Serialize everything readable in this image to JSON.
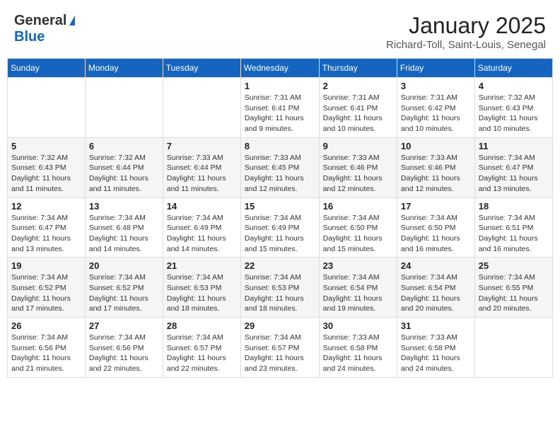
{
  "header": {
    "logo_general": "General",
    "logo_blue": "Blue",
    "main_title": "January 2025",
    "subtitle": "Richard-Toll, Saint-Louis, Senegal"
  },
  "calendar": {
    "days_of_week": [
      "Sunday",
      "Monday",
      "Tuesday",
      "Wednesday",
      "Thursday",
      "Friday",
      "Saturday"
    ],
    "weeks": [
      [
        {
          "day": "",
          "info": ""
        },
        {
          "day": "",
          "info": ""
        },
        {
          "day": "",
          "info": ""
        },
        {
          "day": "1",
          "info": "Sunrise: 7:31 AM\nSunset: 6:41 PM\nDaylight: 11 hours and 9 minutes."
        },
        {
          "day": "2",
          "info": "Sunrise: 7:31 AM\nSunset: 6:41 PM\nDaylight: 11 hours and 10 minutes."
        },
        {
          "day": "3",
          "info": "Sunrise: 7:31 AM\nSunset: 6:42 PM\nDaylight: 11 hours and 10 minutes."
        },
        {
          "day": "4",
          "info": "Sunrise: 7:32 AM\nSunset: 6:43 PM\nDaylight: 11 hours and 10 minutes."
        }
      ],
      [
        {
          "day": "5",
          "info": "Sunrise: 7:32 AM\nSunset: 6:43 PM\nDaylight: 11 hours and 11 minutes."
        },
        {
          "day": "6",
          "info": "Sunrise: 7:32 AM\nSunset: 6:44 PM\nDaylight: 11 hours and 11 minutes."
        },
        {
          "day": "7",
          "info": "Sunrise: 7:33 AM\nSunset: 6:44 PM\nDaylight: 11 hours and 11 minutes."
        },
        {
          "day": "8",
          "info": "Sunrise: 7:33 AM\nSunset: 6:45 PM\nDaylight: 11 hours and 12 minutes."
        },
        {
          "day": "9",
          "info": "Sunrise: 7:33 AM\nSunset: 6:46 PM\nDaylight: 11 hours and 12 minutes."
        },
        {
          "day": "10",
          "info": "Sunrise: 7:33 AM\nSunset: 6:46 PM\nDaylight: 11 hours and 12 minutes."
        },
        {
          "day": "11",
          "info": "Sunrise: 7:34 AM\nSunset: 6:47 PM\nDaylight: 11 hours and 13 minutes."
        }
      ],
      [
        {
          "day": "12",
          "info": "Sunrise: 7:34 AM\nSunset: 6:47 PM\nDaylight: 11 hours and 13 minutes."
        },
        {
          "day": "13",
          "info": "Sunrise: 7:34 AM\nSunset: 6:48 PM\nDaylight: 11 hours and 14 minutes."
        },
        {
          "day": "14",
          "info": "Sunrise: 7:34 AM\nSunset: 6:49 PM\nDaylight: 11 hours and 14 minutes."
        },
        {
          "day": "15",
          "info": "Sunrise: 7:34 AM\nSunset: 6:49 PM\nDaylight: 11 hours and 15 minutes."
        },
        {
          "day": "16",
          "info": "Sunrise: 7:34 AM\nSunset: 6:50 PM\nDaylight: 11 hours and 15 minutes."
        },
        {
          "day": "17",
          "info": "Sunrise: 7:34 AM\nSunset: 6:50 PM\nDaylight: 11 hours and 16 minutes."
        },
        {
          "day": "18",
          "info": "Sunrise: 7:34 AM\nSunset: 6:51 PM\nDaylight: 11 hours and 16 minutes."
        }
      ],
      [
        {
          "day": "19",
          "info": "Sunrise: 7:34 AM\nSunset: 6:52 PM\nDaylight: 11 hours and 17 minutes."
        },
        {
          "day": "20",
          "info": "Sunrise: 7:34 AM\nSunset: 6:52 PM\nDaylight: 11 hours and 17 minutes."
        },
        {
          "day": "21",
          "info": "Sunrise: 7:34 AM\nSunset: 6:53 PM\nDaylight: 11 hours and 18 minutes."
        },
        {
          "day": "22",
          "info": "Sunrise: 7:34 AM\nSunset: 6:53 PM\nDaylight: 11 hours and 18 minutes."
        },
        {
          "day": "23",
          "info": "Sunrise: 7:34 AM\nSunset: 6:54 PM\nDaylight: 11 hours and 19 minutes."
        },
        {
          "day": "24",
          "info": "Sunrise: 7:34 AM\nSunset: 6:54 PM\nDaylight: 11 hours and 20 minutes."
        },
        {
          "day": "25",
          "info": "Sunrise: 7:34 AM\nSunset: 6:55 PM\nDaylight: 11 hours and 20 minutes."
        }
      ],
      [
        {
          "day": "26",
          "info": "Sunrise: 7:34 AM\nSunset: 6:56 PM\nDaylight: 11 hours and 21 minutes."
        },
        {
          "day": "27",
          "info": "Sunrise: 7:34 AM\nSunset: 6:56 PM\nDaylight: 11 hours and 22 minutes."
        },
        {
          "day": "28",
          "info": "Sunrise: 7:34 AM\nSunset: 6:57 PM\nDaylight: 11 hours and 22 minutes."
        },
        {
          "day": "29",
          "info": "Sunrise: 7:34 AM\nSunset: 6:57 PM\nDaylight: 11 hours and 23 minutes."
        },
        {
          "day": "30",
          "info": "Sunrise: 7:33 AM\nSunset: 6:58 PM\nDaylight: 11 hours and 24 minutes."
        },
        {
          "day": "31",
          "info": "Sunrise: 7:33 AM\nSunset: 6:58 PM\nDaylight: 11 hours and 24 minutes."
        },
        {
          "day": "",
          "info": ""
        }
      ]
    ]
  }
}
